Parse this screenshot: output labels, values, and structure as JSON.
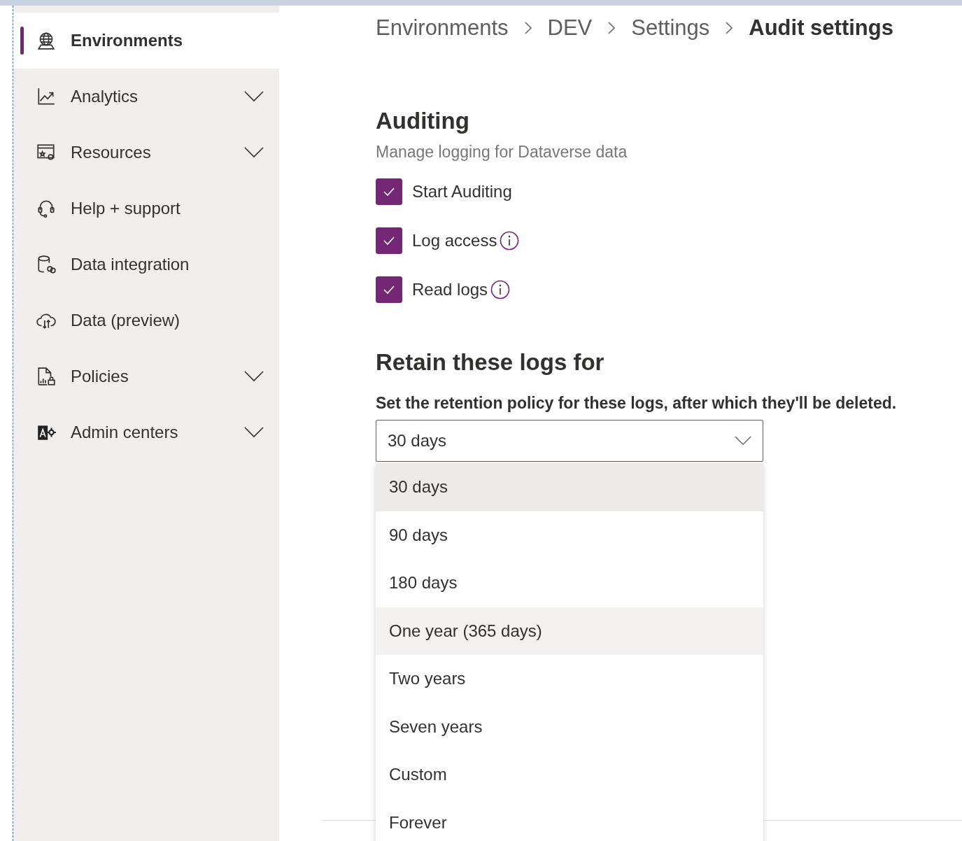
{
  "sidebar": {
    "items": [
      {
        "label": "Environments",
        "kind": "link",
        "selected": true
      },
      {
        "label": "Analytics",
        "kind": "group",
        "selected": false
      },
      {
        "label": "Resources",
        "kind": "group",
        "selected": false
      },
      {
        "label": "Help + support",
        "kind": "link",
        "selected": false
      },
      {
        "label": "Data integration",
        "kind": "link",
        "selected": false
      },
      {
        "label": "Data (preview)",
        "kind": "link",
        "selected": false
      },
      {
        "label": "Policies",
        "kind": "group",
        "selected": false
      },
      {
        "label": "Admin centers",
        "kind": "group",
        "selected": false
      }
    ]
  },
  "breadcrumb": [
    {
      "label": "Environments",
      "current": false
    },
    {
      "label": "DEV",
      "current": false
    },
    {
      "label": "Settings",
      "current": false
    },
    {
      "label": "Audit settings",
      "current": true
    }
  ],
  "auditing": {
    "title": "Auditing",
    "subtitle": "Manage logging for Dataverse data",
    "options": [
      {
        "label": "Start Auditing",
        "checked": true,
        "info": false
      },
      {
        "label": "Log access",
        "checked": true,
        "info": true
      },
      {
        "label": "Read logs",
        "checked": true,
        "info": true
      }
    ]
  },
  "retention": {
    "title": "Retain these logs for",
    "description": "Set the retention policy for these logs, after which they'll be deleted.",
    "dropdown": {
      "value": "30 days",
      "expanded": true,
      "options": [
        {
          "label": "30 days",
          "selected": true,
          "hovered": false
        },
        {
          "label": "90 days",
          "selected": false,
          "hovered": false
        },
        {
          "label": "180 days",
          "selected": false,
          "hovered": false
        },
        {
          "label": "One year (365 days)",
          "selected": false,
          "hovered": true
        },
        {
          "label": "Two years",
          "selected": false,
          "hovered": false
        },
        {
          "label": "Seven years",
          "selected": false,
          "hovered": false
        },
        {
          "label": "Custom",
          "selected": false,
          "hovered": false
        },
        {
          "label": "Forever",
          "selected": false,
          "hovered": false
        }
      ]
    }
  }
}
